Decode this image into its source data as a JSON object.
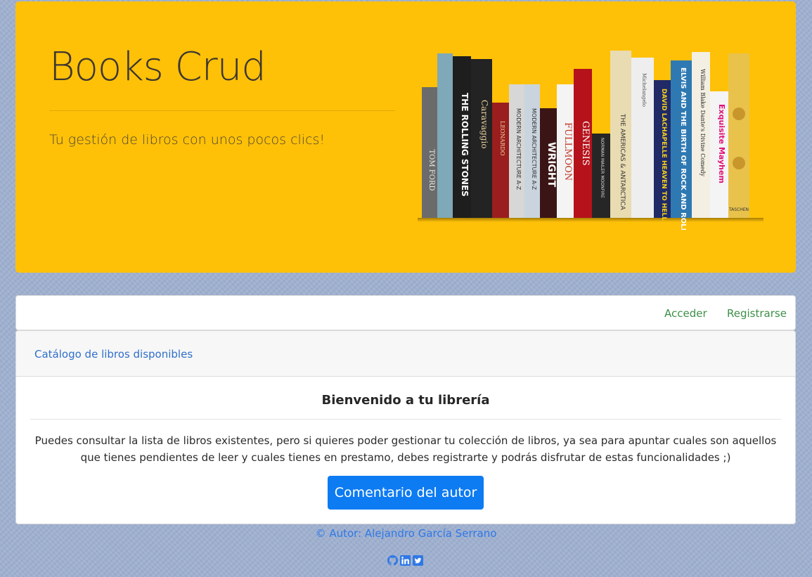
{
  "jumbotron": {
    "title": "Books Crud",
    "tagline": "Tu gestión de libros con unos pocos clics!"
  },
  "navbar": {
    "login": "Acceder",
    "register": "Registrarse"
  },
  "card": {
    "catalog_link": "Catálogo de libros disponibles",
    "welcome_title": "Bienvenido a tu librería",
    "description": "Puedes consultar la lista de libros existentes, pero si quieres poder gestionar tu colección de libros, ya sea para apuntar cuales son aquellos que tienes pendientes de leer y cuales tienes en prestamo, debes registrarte y podrás disfrutar de estas funcionalidades ;)",
    "author_button": "Comentario del autor"
  },
  "footer": {
    "author": "© Autor: Alejandro García Serrano",
    "socials": [
      "github-icon",
      "linkedin-icon",
      "twitter-icon"
    ]
  },
  "colors": {
    "jumbotron_bg": "#ffc107",
    "nav_link": "#3d8f48",
    "primary": "#0d7bf2",
    "link": "#2f6fc9"
  },
  "book_spines": [
    "TOM FORD",
    "THE ROLLING STONES",
    "Caravaggio",
    "LEONARDO",
    "MODERN ARCHITECTURE A-Z",
    "MODERN ARCHITECTURE A-Z",
    "WRIGHT",
    "FULLMOON",
    "GENESIS",
    "NORMAN MAILER MOONFIRE",
    "THE AMERICAS & ANTARCTICA",
    "Michelangelo",
    "DAVID LACHAPELLE HEAVEN TO HELL",
    "ELVIS AND THE BIRTH OF ROCK AND ROLL",
    "William Blake Dante's Divine Comedy",
    "Exquisite Mayhem",
    "TASCHEN"
  ]
}
